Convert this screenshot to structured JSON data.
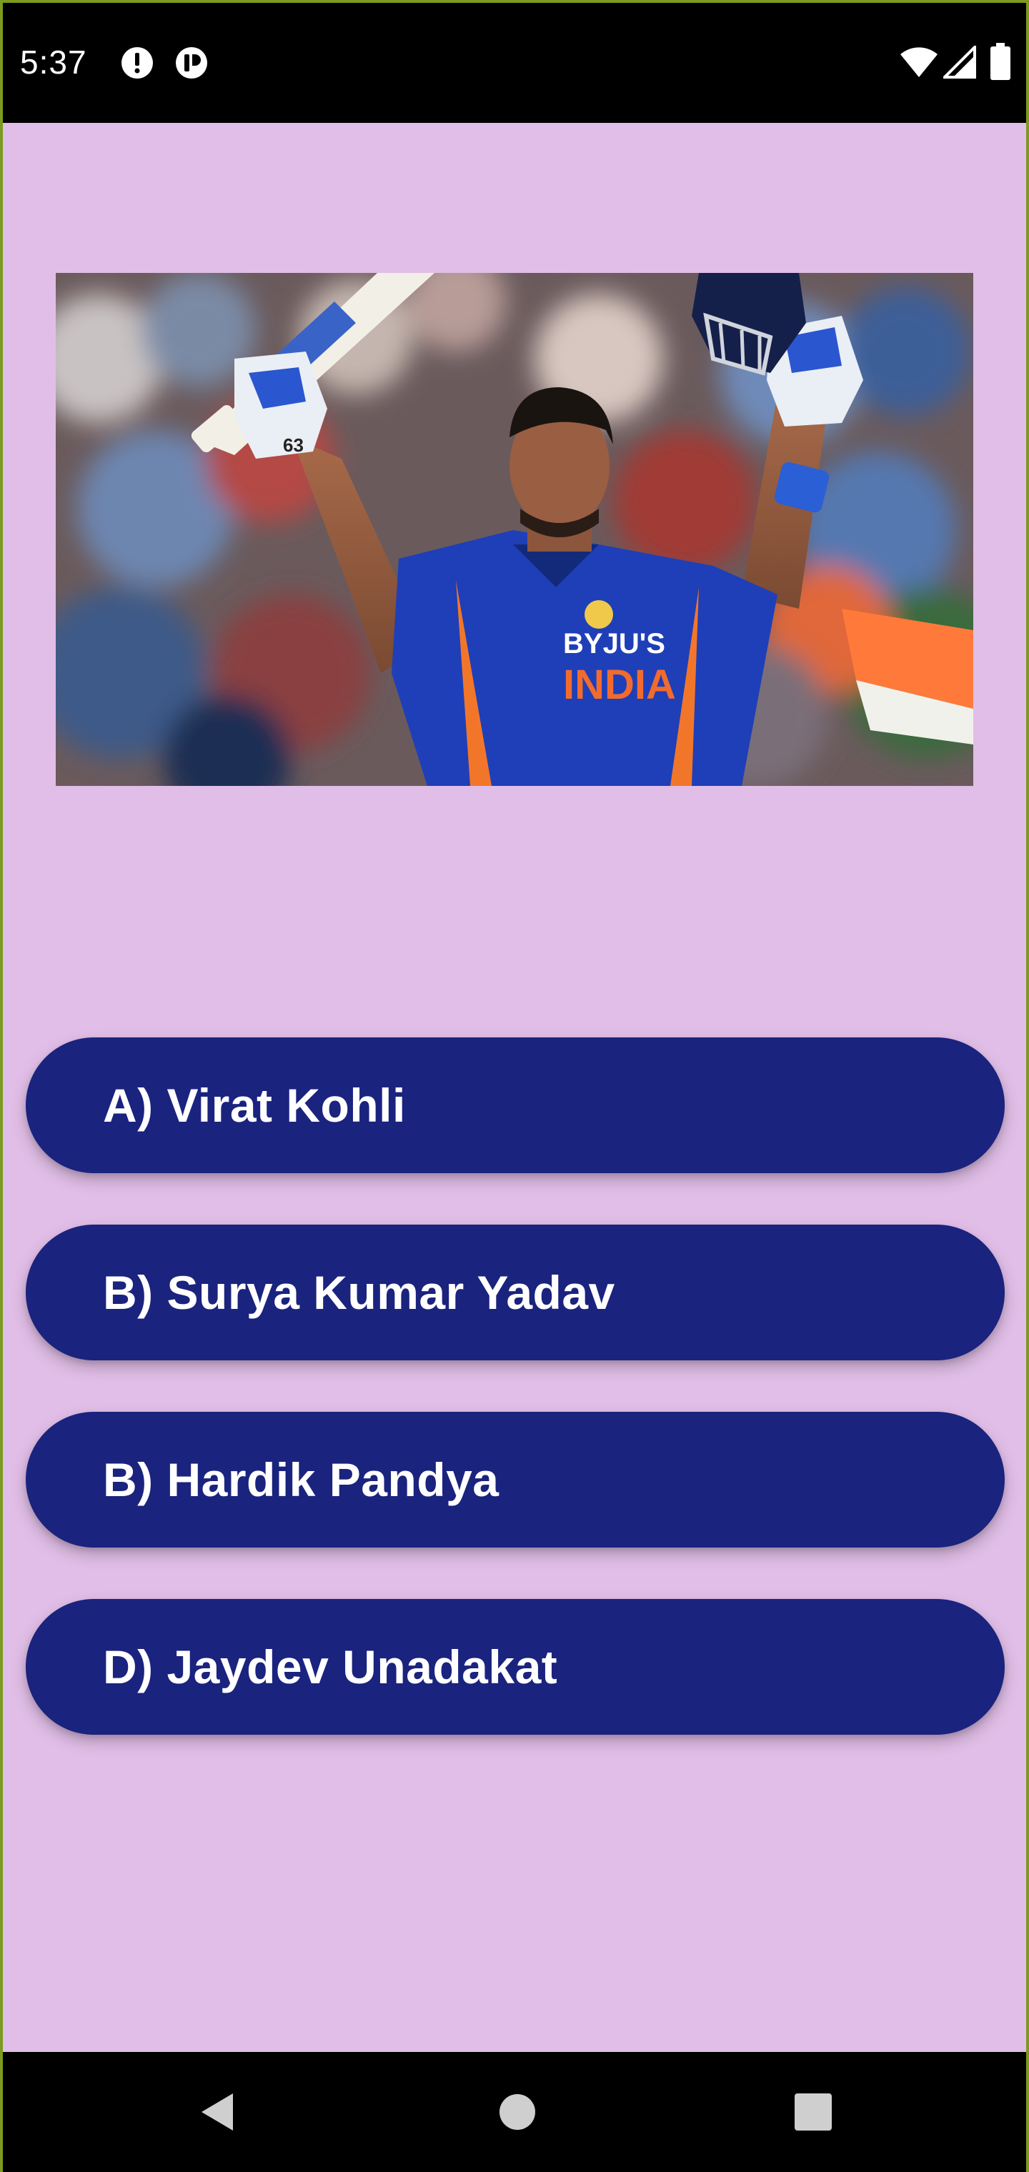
{
  "status_bar": {
    "time": "5:37",
    "left_icons": [
      "alert-icon",
      "accessibility-icon"
    ],
    "right_icons": [
      "wifi-icon",
      "signal-icon",
      "battery-icon"
    ]
  },
  "question": {
    "image_icon": "cricket-player-image"
  },
  "answers": [
    {
      "label": "A) Virat Kohli"
    },
    {
      "label": "B) Surya Kumar Yadav"
    },
    {
      "label": "B) Hardik Pandya"
    },
    {
      "label": "D) Jaydev Unadakat"
    }
  ],
  "nav_bar": {
    "buttons": [
      "back-icon",
      "home-icon",
      "recents-icon"
    ]
  },
  "colors": {
    "background": "#e1bee7",
    "button": "#1a237e",
    "button_text": "#ffffff"
  }
}
